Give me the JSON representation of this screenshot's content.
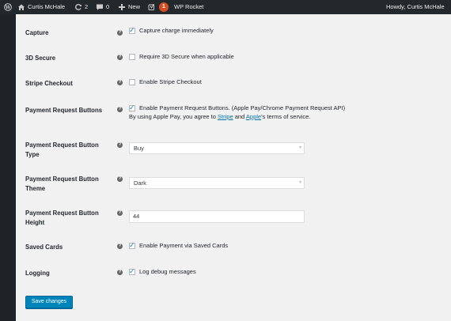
{
  "adminbar": {
    "site_name": "Curtis McHale",
    "updates_count": "2",
    "comments_count": "0",
    "new_label": "New",
    "notifications_count": "1",
    "plugin_label": "WP Rocket",
    "greeting": "Howdy, Curtis McHale"
  },
  "settings": {
    "capture": {
      "label": "Capture",
      "checked": true,
      "text": "Capture charge immediately"
    },
    "three_d_secure": {
      "label": "3D Secure",
      "checked": false,
      "text": "Require 3D Secure when applicable"
    },
    "stripe_checkout": {
      "label": "Stripe Checkout",
      "checked": false,
      "text": "Enable Stripe Checkout"
    },
    "payment_request": {
      "label": "Payment Request Buttons",
      "checked": true,
      "text": "Enable Payment Request Buttons. (Apple Pay/Chrome Payment Request API)",
      "note_prefix": "By using Apple Pay, you agree to ",
      "link_stripe": "Stripe",
      "note_and": " and ",
      "link_apple": "Apple",
      "note_suffix": "'s terms of service."
    },
    "button_type": {
      "label_line1": "Payment Request Button",
      "label_line2": "Type",
      "value": "Buy"
    },
    "button_theme": {
      "label_line1": "Payment Request Button",
      "label_line2": "Theme",
      "value": "Dark"
    },
    "button_height": {
      "label_line1": "Payment Request Button",
      "label_line2": "Height",
      "value": "44"
    },
    "saved_cards": {
      "label": "Saved Cards",
      "checked": true,
      "text": "Enable Payment via Saved Cards"
    },
    "logging": {
      "label": "Logging",
      "checked": true,
      "text": "Log debug messages"
    }
  },
  "save_button_label": "Save changes",
  "help_glyph": "?",
  "check_glyph": "✓",
  "icons": {
    "wp": "wordpress-icon",
    "home": "home-icon",
    "updates": "updates-icon",
    "comments": "comment-icon",
    "new": "plus-icon",
    "yoast": "yoast-icon",
    "help": "help-icon"
  }
}
